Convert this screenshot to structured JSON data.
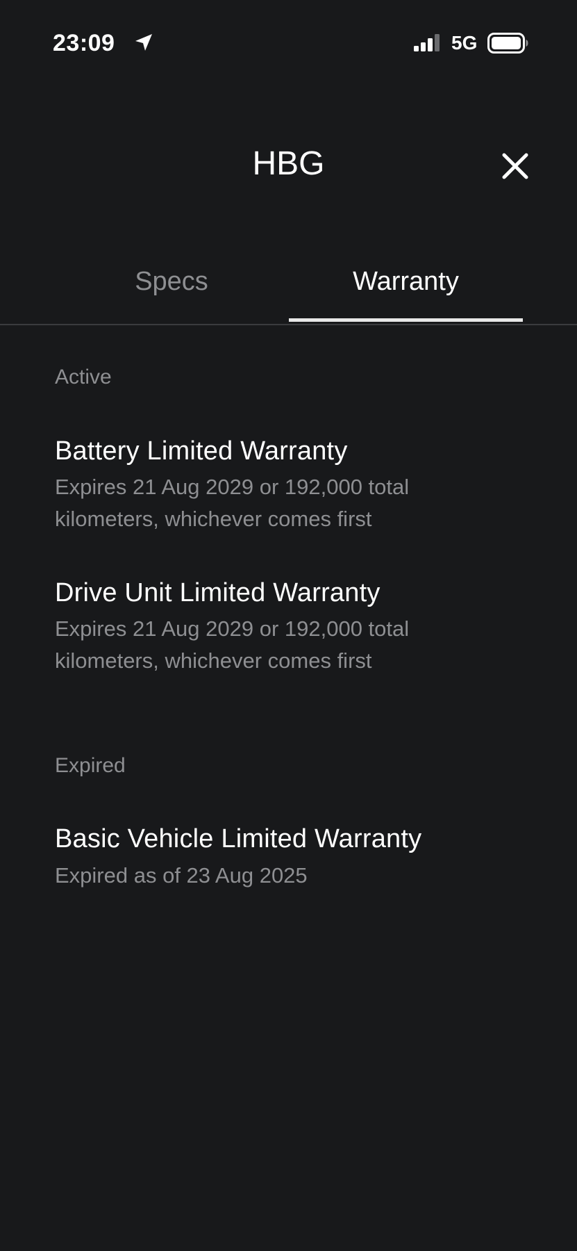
{
  "status_bar": {
    "time": "23:09",
    "network": "5G",
    "icons": [
      "location-arrow-icon",
      "signal-bars-icon",
      "battery-icon"
    ]
  },
  "header": {
    "title": "HBG",
    "close_icon": "close-icon"
  },
  "tabs": [
    {
      "label": "Specs",
      "active": false
    },
    {
      "label": "Warranty",
      "active": true
    }
  ],
  "warranty": {
    "active_label": "Active",
    "active_items": [
      {
        "title": "Battery Limited Warranty",
        "description": "Expires 21 Aug 2029 or 192,000 total kilometers, whichever comes first"
      },
      {
        "title": "Drive Unit Limited Warranty",
        "description": "Expires 21 Aug 2029 or 192,000 total kilometers, whichever comes first"
      }
    ],
    "expired_label": "Expired",
    "expired_items": [
      {
        "title": "Basic Vehicle Limited Warranty",
        "description": "Expired as of 23 Aug 2025"
      }
    ]
  },
  "colors": {
    "background": "#18191b",
    "text_primary": "#ffffff",
    "text_secondary": "#8e8f92",
    "tab_indicator": "#e8e8e8",
    "divider": "#3a3b3e"
  }
}
